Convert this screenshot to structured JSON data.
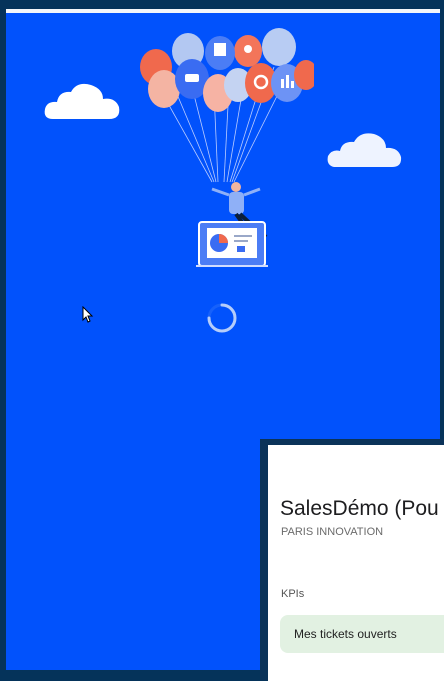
{
  "loading_screen": {
    "illustration": "balloons-with-person-and-dashboard-laptop",
    "status": "loading",
    "spinner_icon": "loading-spinner-icon"
  },
  "app_card": {
    "title": "SalesDémo (Pou",
    "subtitle": "PARIS INNOVATION",
    "section_label": "KPIs",
    "kpi_button_label": "Mes tickets ouverts"
  },
  "colors": {
    "splash_background": "#0152fc",
    "frame": "#05335a",
    "chip_background": "#e2f1e2"
  }
}
